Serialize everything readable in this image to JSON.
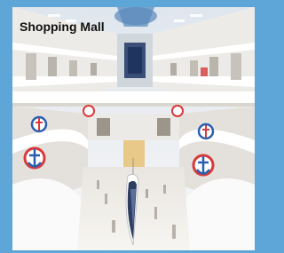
{
  "card": {
    "caption": "Shopping Mall",
    "photo_subject": "shopping-mall-atrium-photo",
    "colors": {
      "frame": "#5ea5d8",
      "caption_text": "#111111",
      "floor": "#f4f2ee",
      "decoration_blue": "#2a5fb0",
      "decoration_red": "#d83a3a"
    }
  }
}
